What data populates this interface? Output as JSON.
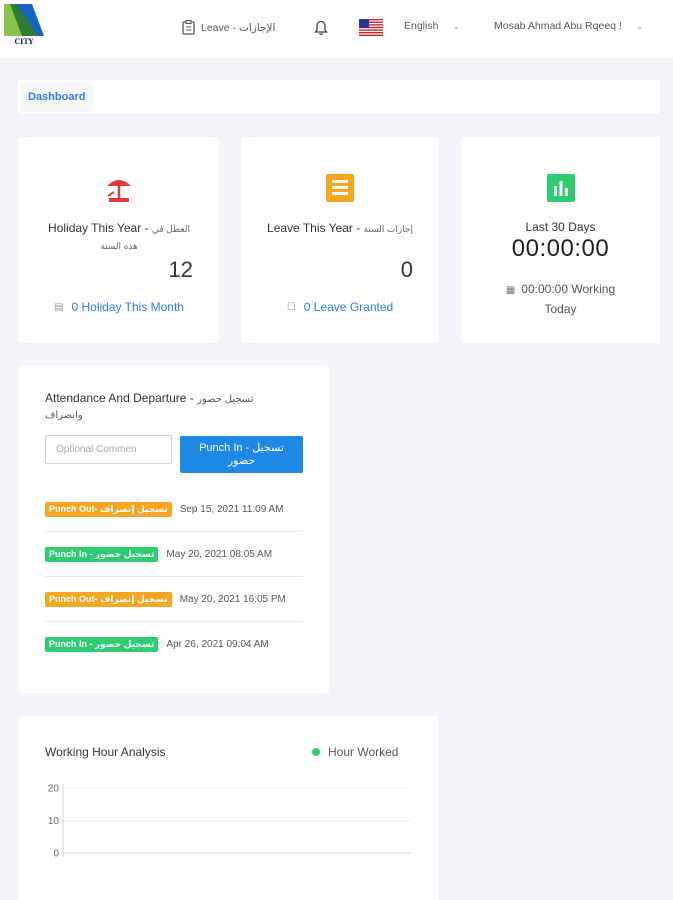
{
  "header": {
    "logo_text": "CITY",
    "leave_menu_label": "Leave - الإجازات",
    "language": "English",
    "user_name": "Mosab Ahmad Abu Rqeeq !"
  },
  "breadcrumb": {
    "current": "Dashboard"
  },
  "cards": {
    "holiday": {
      "title_en": "Holiday This Year - ",
      "title_ar": "العطل في هذه السنة",
      "value": "12",
      "link": "0 Holiday This Month",
      "icon": "beach-umbrella-icon",
      "icon_color": "#e53935"
    },
    "leave": {
      "title_en": "Leave This Year - ",
      "title_ar": "إجازات السنة",
      "value": "0",
      "link": "0 Leave Granted",
      "icon": "document-list-icon",
      "icon_color": "#f5a623"
    },
    "last30": {
      "title": "Last 30 Days",
      "timer": "00:00:00",
      "working_today": "00:00:00 Working Today",
      "icon": "bar-chart-icon",
      "icon_color": "#2ecc71"
    }
  },
  "attendance": {
    "title_en": "Attendance And Departure - ",
    "title_ar": "تسجيل حضور وانصراف",
    "comment_placeholder": "Optional Commen",
    "punch_button": "Punch In - تسجيل حضور",
    "records": [
      {
        "badge": "Punch Out- تسجيل إنصراف",
        "type": "out",
        "date": "Sep 15, 2021 11:09 AM"
      },
      {
        "badge": "Punch In - تسجيل حضور",
        "type": "in",
        "date": "May 20, 2021 08:05 AM"
      },
      {
        "badge": "Punch Out- تسجيل إنصراف",
        "type": "out",
        "date": "May 20, 2021 16:05 PM"
      },
      {
        "badge": "Punch In - تسجيل حضور",
        "type": "in",
        "date": "Apr 26, 2021 09:04 AM"
      }
    ]
  },
  "chart_data": {
    "type": "line",
    "title": "Working Hour Analysis",
    "series": [
      {
        "name": "Hour Worked",
        "values": []
      }
    ],
    "yticks": [
      "20",
      "10",
      "0"
    ],
    "ylim": [
      0,
      20
    ],
    "grid": true,
    "legend_position": "top-right",
    "colors": {
      "series": "#2ecc71"
    }
  },
  "colors": {
    "accent": "#2f7bdb",
    "primary_button": "#1e88e5",
    "punch_out": "#f5a623",
    "punch_in": "#2ecc71"
  }
}
